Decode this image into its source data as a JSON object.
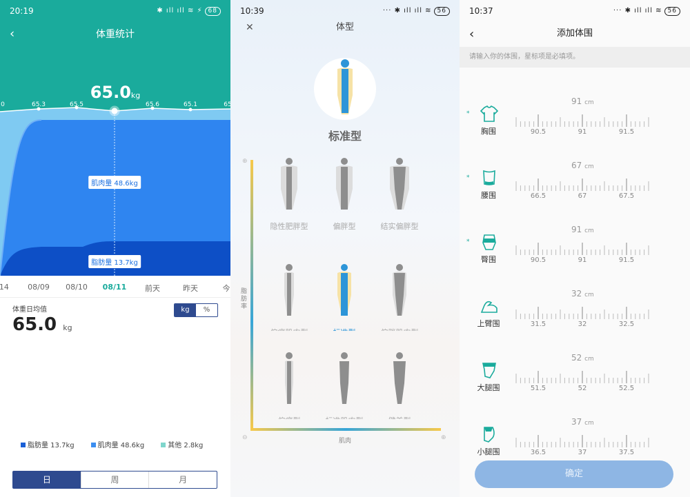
{
  "screen1": {
    "status": {
      "time": "20:19",
      "battery": "68"
    },
    "title": "体重统计",
    "current_weight": "65.0",
    "current_unit": "kg",
    "point_values": [
      "0",
      "65.3",
      "65.5",
      "65.6",
      "65.1",
      "65"
    ],
    "muscle_label": "肌肉量 48.6kg",
    "fat_label": "脂肪量 13.7kg",
    "dates": [
      "/14",
      "08/09",
      "08/10",
      "08/11",
      "前天",
      "昨天",
      "今"
    ],
    "avg_label": "体重日均值",
    "avg_value": "65.0",
    "avg_unit": "kg",
    "unit_toggle": [
      "kg",
      "%"
    ],
    "legend": [
      {
        "label": "脂肪量 13.7kg",
        "color": "#1a5fd6"
      },
      {
        "label": "肌肉量 48.6kg",
        "color": "#3b8ef0"
      },
      {
        "label": "其他 2.8kg",
        "color": "#7fd6cc"
      }
    ],
    "period_tabs": [
      "日",
      "周",
      "月"
    ],
    "colors": {
      "header": "#1aab9c",
      "muscle": "#2f85f0",
      "fat": "#0d4fc6",
      "accent": "#2e4a8f"
    }
  },
  "screen2": {
    "status": {
      "time": "10:39",
      "battery": "56"
    },
    "title": "体型",
    "close_icon": "close-icon",
    "selected_type": "标准型",
    "top_row_labels": [
      "隐性肥胖型",
      "偏胖型",
      "结实偏胖型"
    ],
    "y_axis_label": "脂肪率",
    "x_axis_label": "肌肉",
    "colors": {
      "figure_gray": "#8e8e8e",
      "figure_blue": "#2d95d8",
      "figure_yellow": "#f6e2a6"
    }
  },
  "screen3": {
    "status": {
      "time": "10:37",
      "battery": "56"
    },
    "title": "添加体围",
    "hint": "请输入你的体围，星标项是必填项。",
    "measurements": [
      {
        "name": "胸围",
        "value": "91",
        "unit": "cm",
        "ticks": [
          "90.5",
          "91",
          "91.5"
        ],
        "required": true,
        "icon": "shirt-icon"
      },
      {
        "name": "腰围",
        "value": "67",
        "unit": "cm",
        "ticks": [
          "66.5",
          "67",
          "67.5"
        ],
        "required": true,
        "icon": "waist-icon"
      },
      {
        "name": "臀围",
        "value": "91",
        "unit": "cm",
        "ticks": [
          "90.5",
          "91",
          "91.5"
        ],
        "required": true,
        "icon": "hip-icon"
      },
      {
        "name": "上臂围",
        "value": "32",
        "unit": "cm",
        "ticks": [
          "31.5",
          "32",
          "32.5"
        ],
        "required": false,
        "icon": "arm-icon"
      },
      {
        "name": "大腿围",
        "value": "52",
        "unit": "cm",
        "ticks": [
          "51.5",
          "52",
          "52.5"
        ],
        "required": false,
        "icon": "thigh-icon"
      },
      {
        "name": "小腿围",
        "value": "37",
        "unit": "cm",
        "ticks": [
          "36.5",
          "37",
          "37.5"
        ],
        "required": false,
        "icon": "calf-icon"
      }
    ],
    "required_mark": "*",
    "confirm_label": "确定",
    "colors": {
      "accent": "#1aab9c",
      "button": "#8eb6e4"
    }
  }
}
